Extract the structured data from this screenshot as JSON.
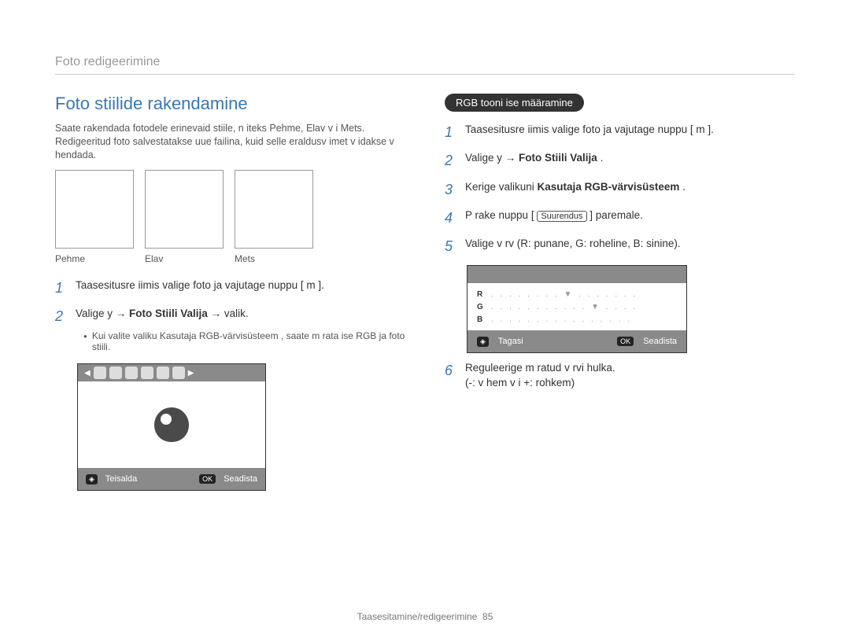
{
  "header": {
    "breadcrumb": "Foto redigeerimine"
  },
  "left": {
    "title": "Foto stiilide rakendamine",
    "intro": "Saate rakendada fotodele erinevaid stiile, n  iteks Pehme, Elav v  i Mets. Redigeeritud foto salvestatakse uue failina, kuid selle eraldusv  imet v  idakse v  hendada.",
    "thumbs": [
      "Pehme",
      "Elav",
      "Mets"
    ],
    "steps": {
      "s1": "Taasesitusre  iimis valige foto ja vajutage nuppu [ m       ].",
      "s2_pre": "Valige y     → ",
      "s2_bold": "Foto Stiili Valija",
      "s2_post": "   → valik.",
      "bullet": "Kui valite valiku Kasutaja RGB-värvisüsteem   , saate m    rata ise RGB ja foto stiili."
    },
    "device": {
      "left_label": "Teisalda",
      "right_label": "Seadista",
      "ok": "OK"
    }
  },
  "right": {
    "pill": "RGB tooni ise määramine",
    "steps": {
      "s1": "Taasesitusre  iimis valige foto ja vajutage nuppu [ m       ].",
      "s2_pre": "Valige y     → ",
      "s2_bold": "Foto Stiili Valija",
      "s2_post": "  .",
      "s3_pre": "Kerige valikuni ",
      "s3_bold": "Kasutaja RGB-värvisüsteem",
      "s3_post": "   .",
      "s4_pre": "P    rake nuppu [ ",
      "s4_key": "Suurendus",
      "s4_post": " ] paremale.",
      "s5": "Valige v  rv (R: punane, G: roheline, B: sinine).",
      "s6_l1": "Reguleerige m    ratud v  rvi hulka.",
      "s6_l2": "(-: v  hem v  i +: rohkem)"
    },
    "rgb_labels": [
      "R",
      "G",
      "B"
    ],
    "device": {
      "left_label": "Tagasi",
      "right_label": "Seadista",
      "ok": "OK"
    }
  },
  "footer": {
    "section": "Taasesitamine/redigeerimine",
    "page": "85"
  }
}
